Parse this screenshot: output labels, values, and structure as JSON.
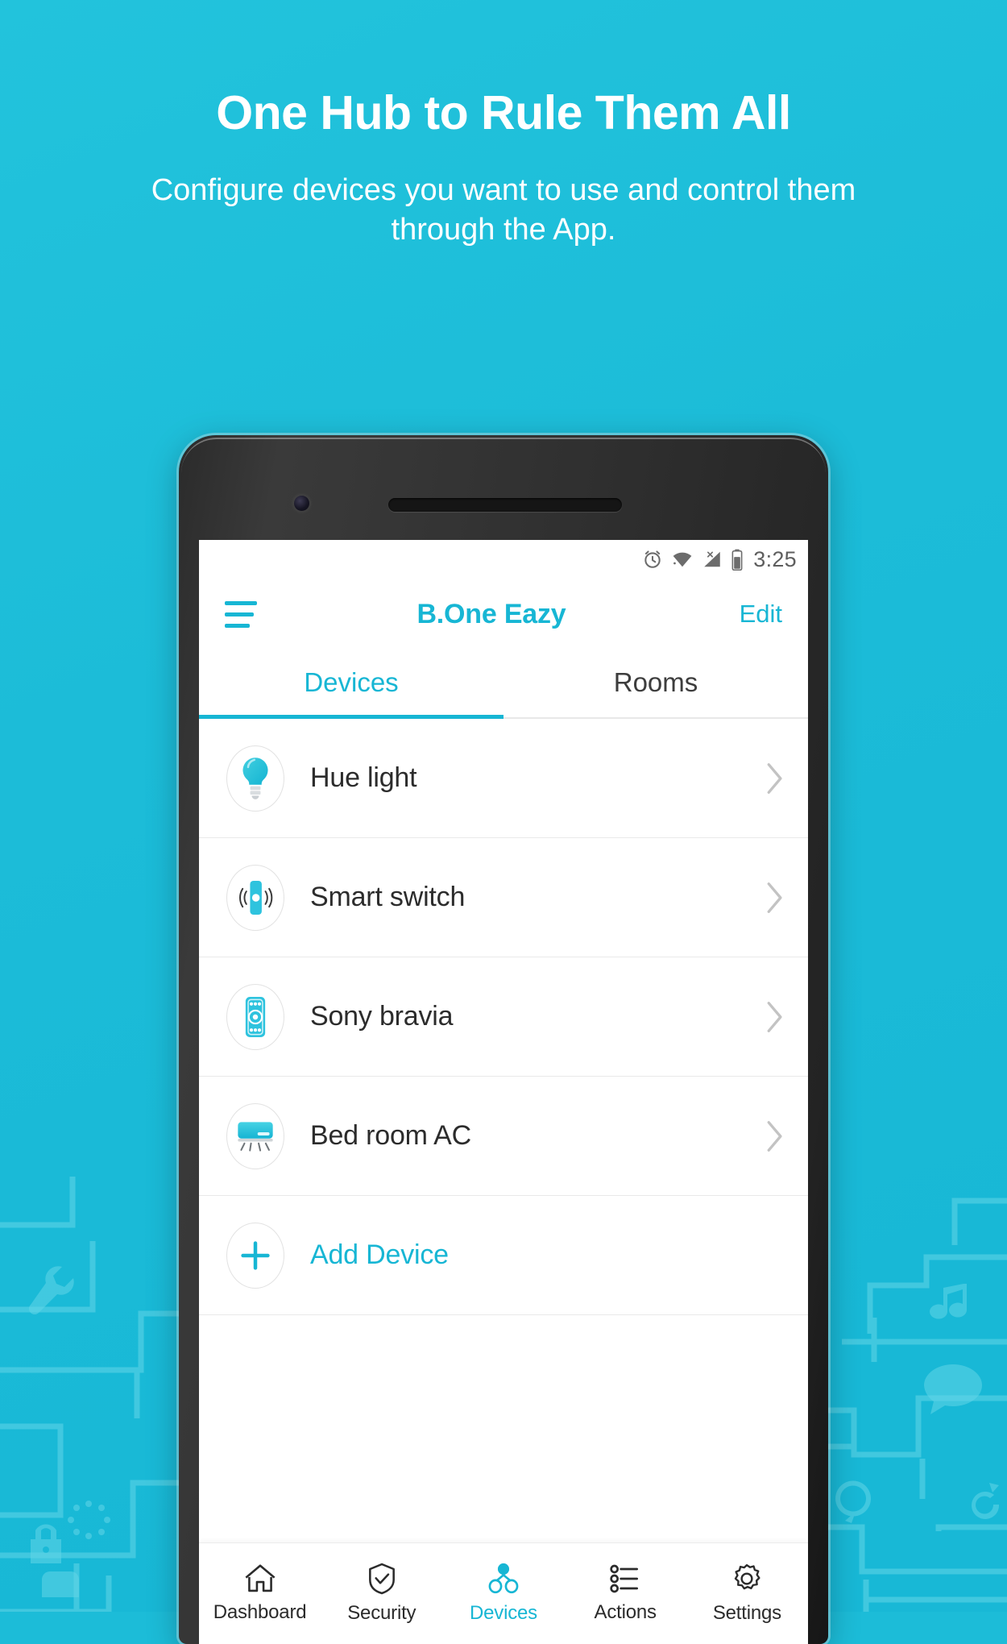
{
  "promo": {
    "title": "One Hub to Rule Them All",
    "subtitle": "Configure devices you want to use and control them through the App."
  },
  "colors": {
    "background": "#1cbcd8",
    "accent": "#17b6d4",
    "text_dark": "#2c2c2c",
    "status_icon": "#6c6c6c"
  },
  "status_bar": {
    "time": "3:25",
    "icons": [
      "alarm-icon",
      "wifi-icon",
      "cellular-off-icon",
      "battery-icon"
    ]
  },
  "app_bar": {
    "menu_icon": "hamburger-menu-icon",
    "title": "B.One Eazy",
    "edit_label": "Edit"
  },
  "tabs": [
    {
      "label": "Devices",
      "active": true
    },
    {
      "label": "Rooms",
      "active": false
    }
  ],
  "devices": [
    {
      "label": "Hue light",
      "icon": "light-bulb-icon"
    },
    {
      "label": "Smart switch",
      "icon": "smart-switch-icon"
    },
    {
      "label": "Sony bravia",
      "icon": "remote-control-icon"
    },
    {
      "label": "Bed room AC",
      "icon": "air-conditioner-icon"
    }
  ],
  "add_device": {
    "label": "Add Device",
    "icon": "plus-icon"
  },
  "bottom_nav": [
    {
      "label": "Dashboard",
      "icon": "home-icon",
      "active": false
    },
    {
      "label": "Security",
      "icon": "shield-check-icon",
      "active": false
    },
    {
      "label": "Devices",
      "icon": "devices-node-icon",
      "active": true
    },
    {
      "label": "Actions",
      "icon": "list-icon",
      "active": false
    },
    {
      "label": "Settings",
      "icon": "gear-icon",
      "active": false
    }
  ]
}
